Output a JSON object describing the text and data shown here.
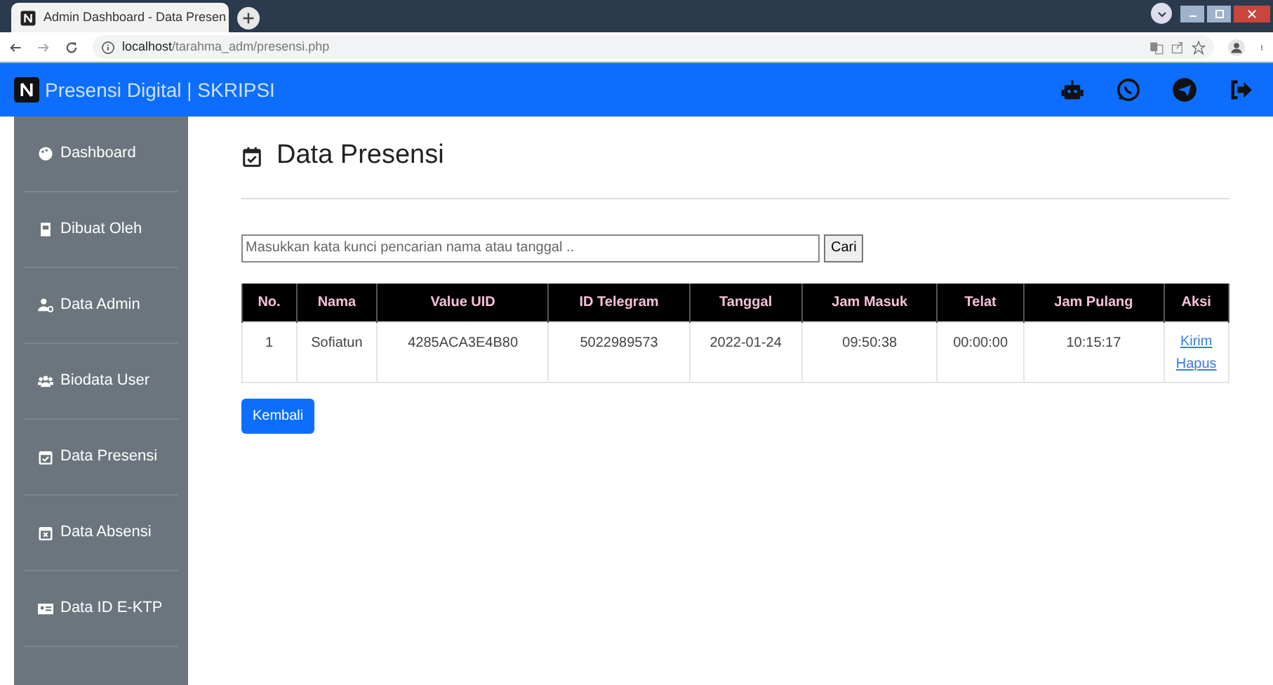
{
  "browser": {
    "tab_title": "Admin Dashboard - Data Presen",
    "url_host": "localhost",
    "url_path": "/tarahma_adm/presensi.php"
  },
  "navbar": {
    "brand": "Presensi Digital | SKRIPSI"
  },
  "sidebar": {
    "items": [
      {
        "label": "Dashboard"
      },
      {
        "label": "Dibuat Oleh"
      },
      {
        "label": "Data Admin"
      },
      {
        "label": "Biodata User"
      },
      {
        "label": "Data Presensi"
      },
      {
        "label": "Data Absensi"
      },
      {
        "label": "Data ID E-KTP"
      }
    ]
  },
  "page": {
    "title": "Data Presensi",
    "search": {
      "placeholder": "Masukkan kata kunci pencarian nama atau tanggal ..",
      "button": "Cari"
    },
    "table": {
      "columns": [
        "No.",
        "Nama",
        "Value UID",
        "ID Telegram",
        "Tanggal",
        "Jam Masuk",
        "Telat",
        "Jam Pulang",
        "Aksi"
      ],
      "rows": [
        {
          "cells": [
            "1",
            "Sofiatun",
            "4285ACA3E4B80",
            "5022989573",
            "2022-01-24",
            "09:50:38",
            "00:00:00",
            "10:15:17"
          ],
          "actions": [
            "Kirim",
            "Hapus"
          ]
        }
      ]
    },
    "back_button": "Kembali"
  }
}
